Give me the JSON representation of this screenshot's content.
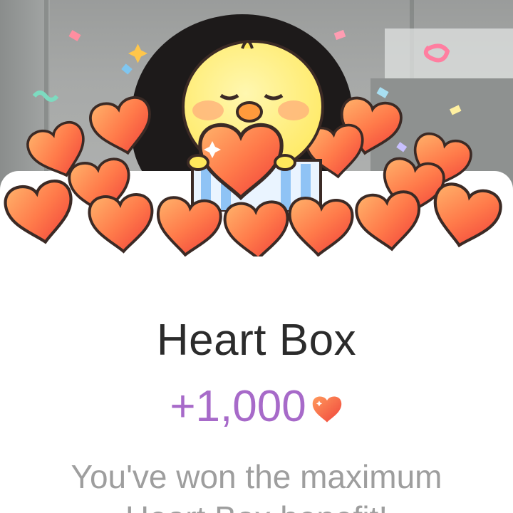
{
  "reward": {
    "title": "Heart Box",
    "amount": "+1,000",
    "currency_icon": "heart-icon",
    "message_line1": "You've won the maximum",
    "message_line2": "Heart Box benefit!"
  },
  "colors": {
    "title": "#2b2b2b",
    "amount": "#a76ac9",
    "message": "#9e9e9e",
    "heart_light": "#ff9a5c",
    "heart_dark": "#f0433b"
  }
}
